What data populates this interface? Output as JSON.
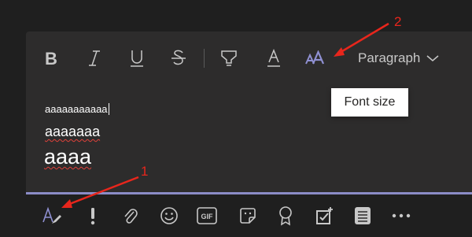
{
  "toolbar": {
    "paragraph_label": "Paragraph"
  },
  "tooltip": {
    "text": "Font size"
  },
  "editor": {
    "line_small": "aaaaaaaaaaa",
    "line_medium": "aaaaaaa",
    "line_large": "aaaa"
  },
  "callouts": {
    "one": "1",
    "two": "2"
  },
  "colors": {
    "accent": "#8b8cc7",
    "arrow": "#e8261c",
    "background": "#1f1f1f",
    "compose_background": "#2d2c2c",
    "spellcheck": "#e0413a"
  },
  "icons": {
    "toolbar": [
      "bold-icon",
      "italic-icon",
      "underline-icon",
      "strikethrough-icon",
      "highlight-icon",
      "font-color-icon",
      "font-size-icon",
      "chevron-down-icon"
    ],
    "bottom_bar": [
      "format-icon",
      "important-icon",
      "attach-icon",
      "emoji-icon",
      "gif-icon",
      "sticker-icon",
      "praise-icon",
      "approvals-icon",
      "stream-icon",
      "more-options-icon"
    ]
  }
}
